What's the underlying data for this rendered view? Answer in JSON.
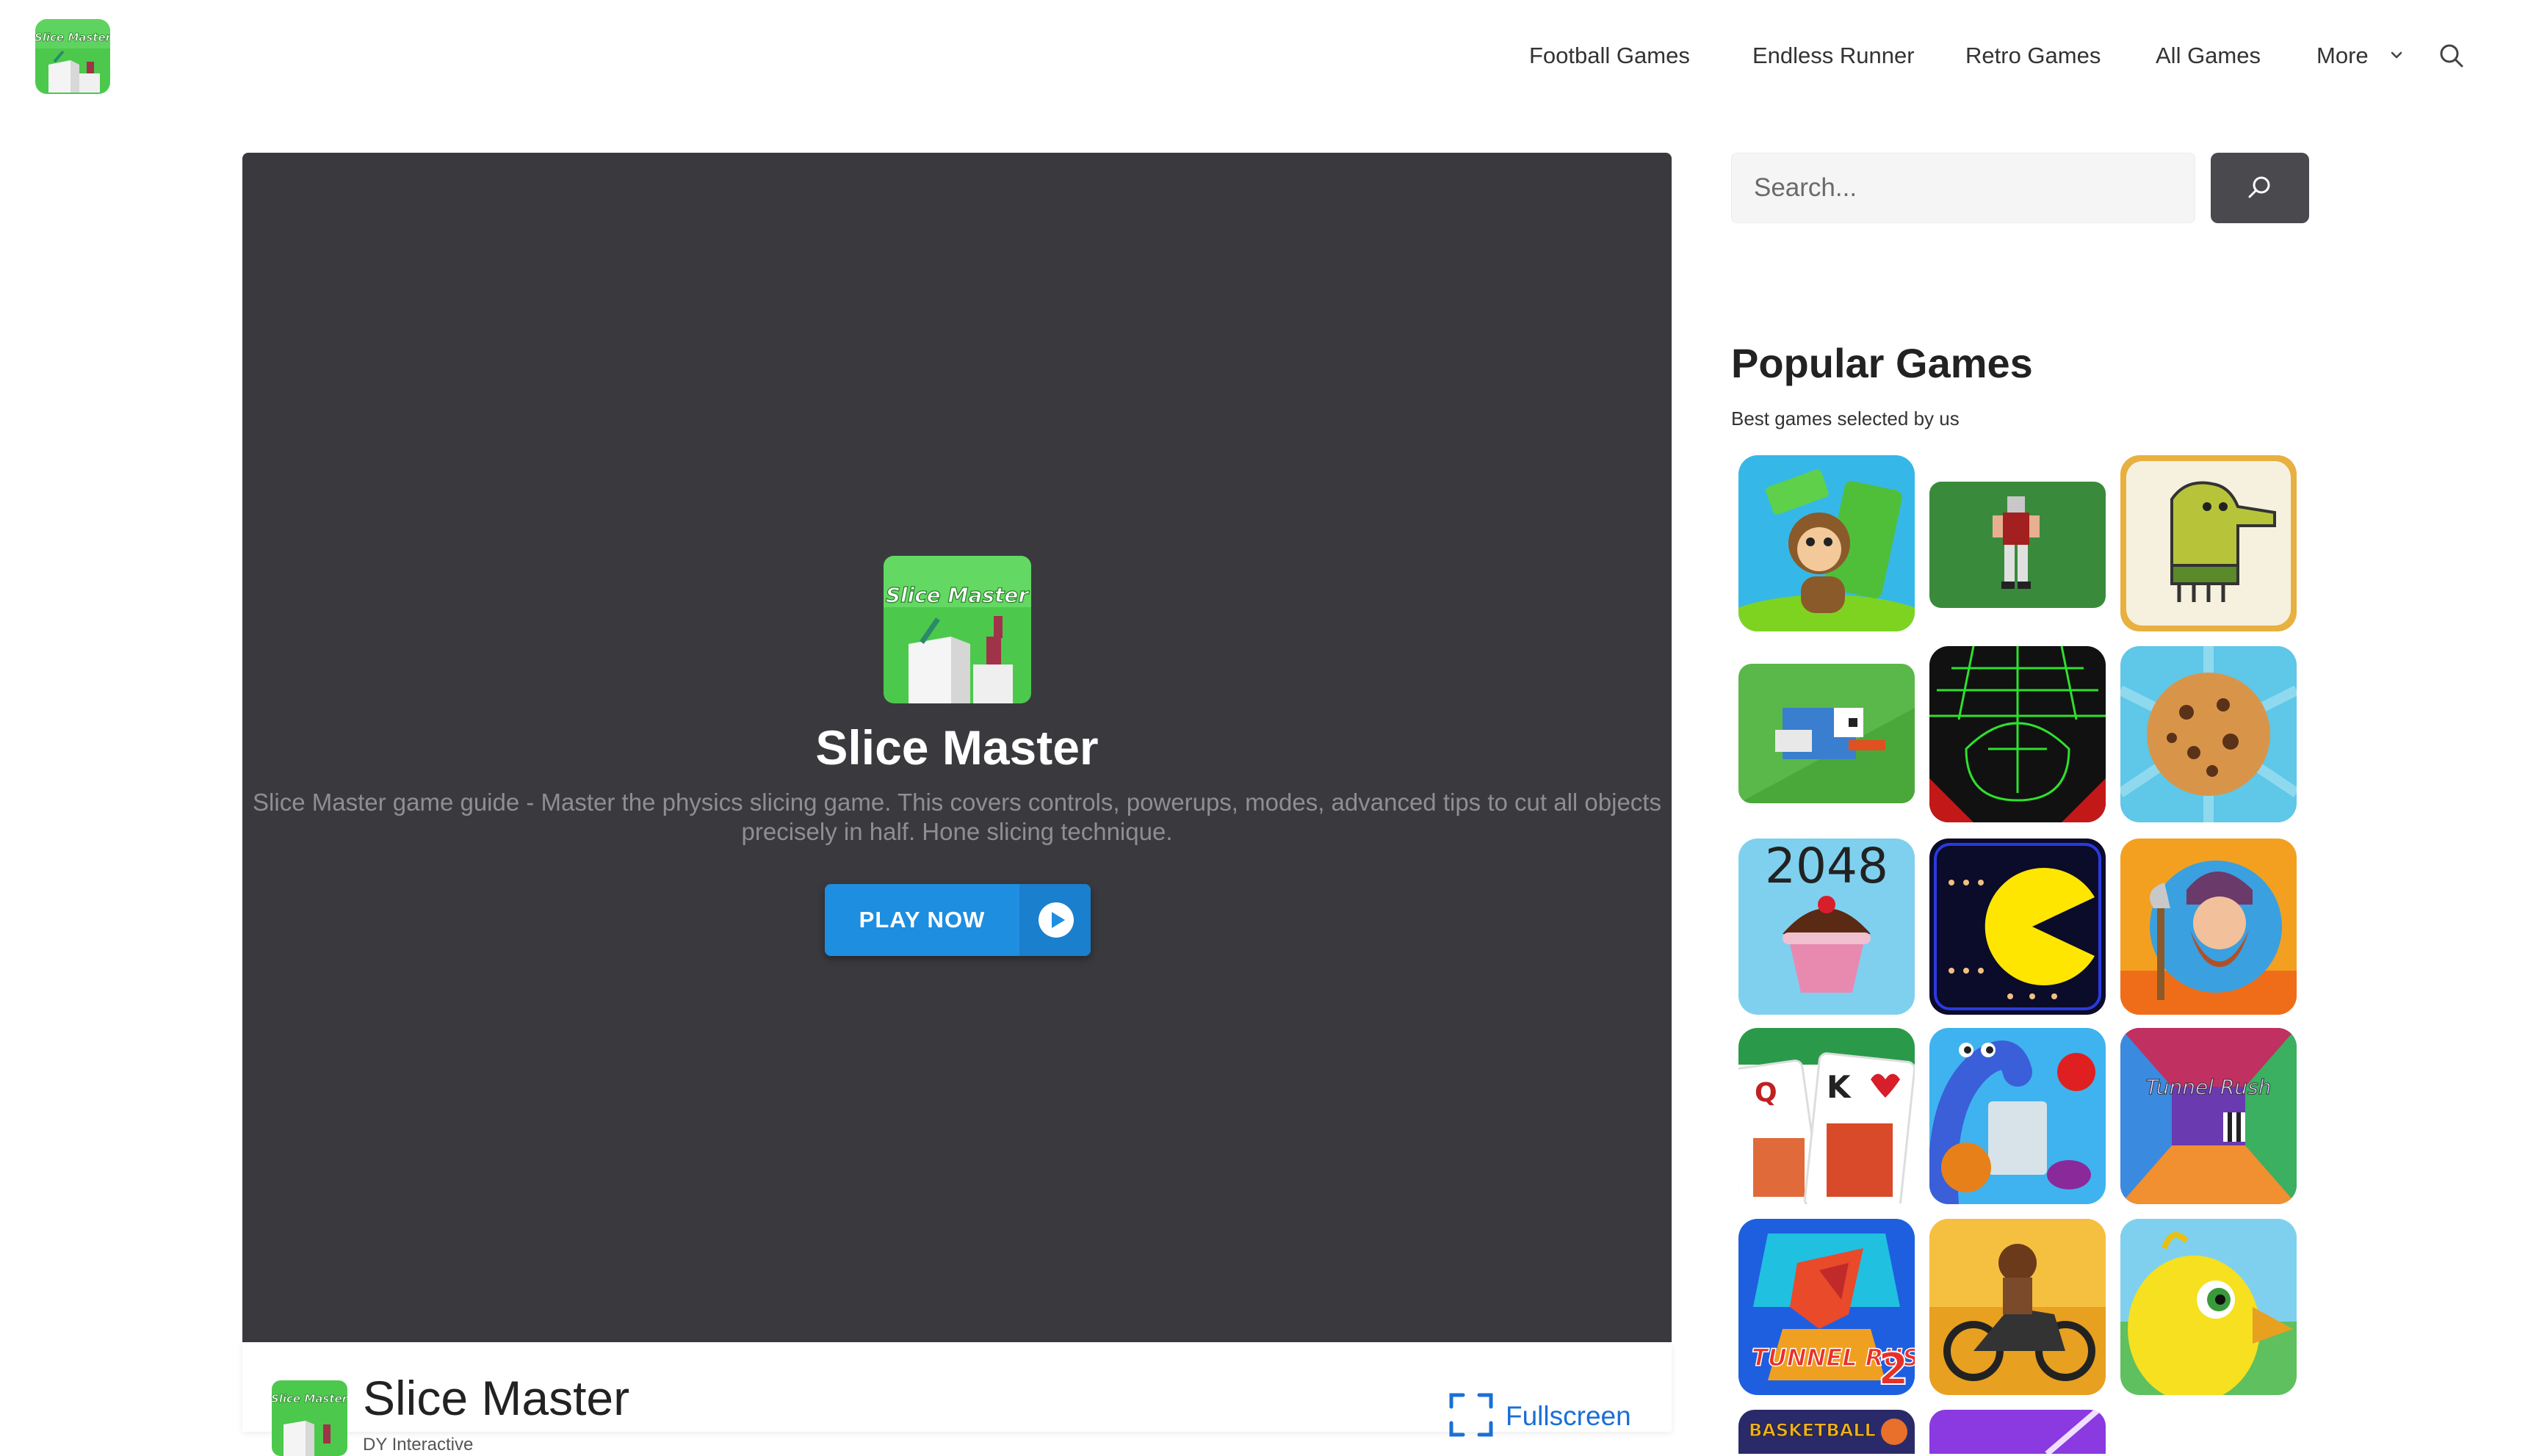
{
  "header": {
    "logo_name": "Slice Master logo",
    "nav": [
      {
        "label": "Football Games"
      },
      {
        "label": "Endless Runner"
      },
      {
        "label": "Retro Games"
      },
      {
        "label": "All Games"
      },
      {
        "label": "More"
      }
    ],
    "search_icon": "search-icon"
  },
  "game": {
    "title": "Slice Master",
    "description": "Slice Master game guide - Master the physics slicing game. This covers controls, powerups, modes, advanced tips to cut all objects precisely in half. Hone slicing technique.",
    "play_label": "PLAY NOW",
    "icon_text": "Slice Master"
  },
  "info": {
    "title": "Slice Master",
    "developer": "DY Interactive",
    "fullscreen_label": "Fullscreen"
  },
  "sidebar": {
    "search_placeholder": "Search...",
    "popular_title": "Popular Games",
    "popular_subtitle": "Best games selected by us",
    "tile_texts": {
      "t2048": "2048",
      "tunnel_rush": "Tunnel Rush",
      "tunnel_rush_2": "TUNNEL RUSH",
      "tunnel_rush_2_num": "2",
      "basketball": "BASKETBALL"
    }
  },
  "colors": {
    "panel_bg": "#3a3a3e",
    "play_button": "#1e8ee0",
    "link_blue": "#1a6fd6",
    "search_button": "#4a4a4e"
  }
}
